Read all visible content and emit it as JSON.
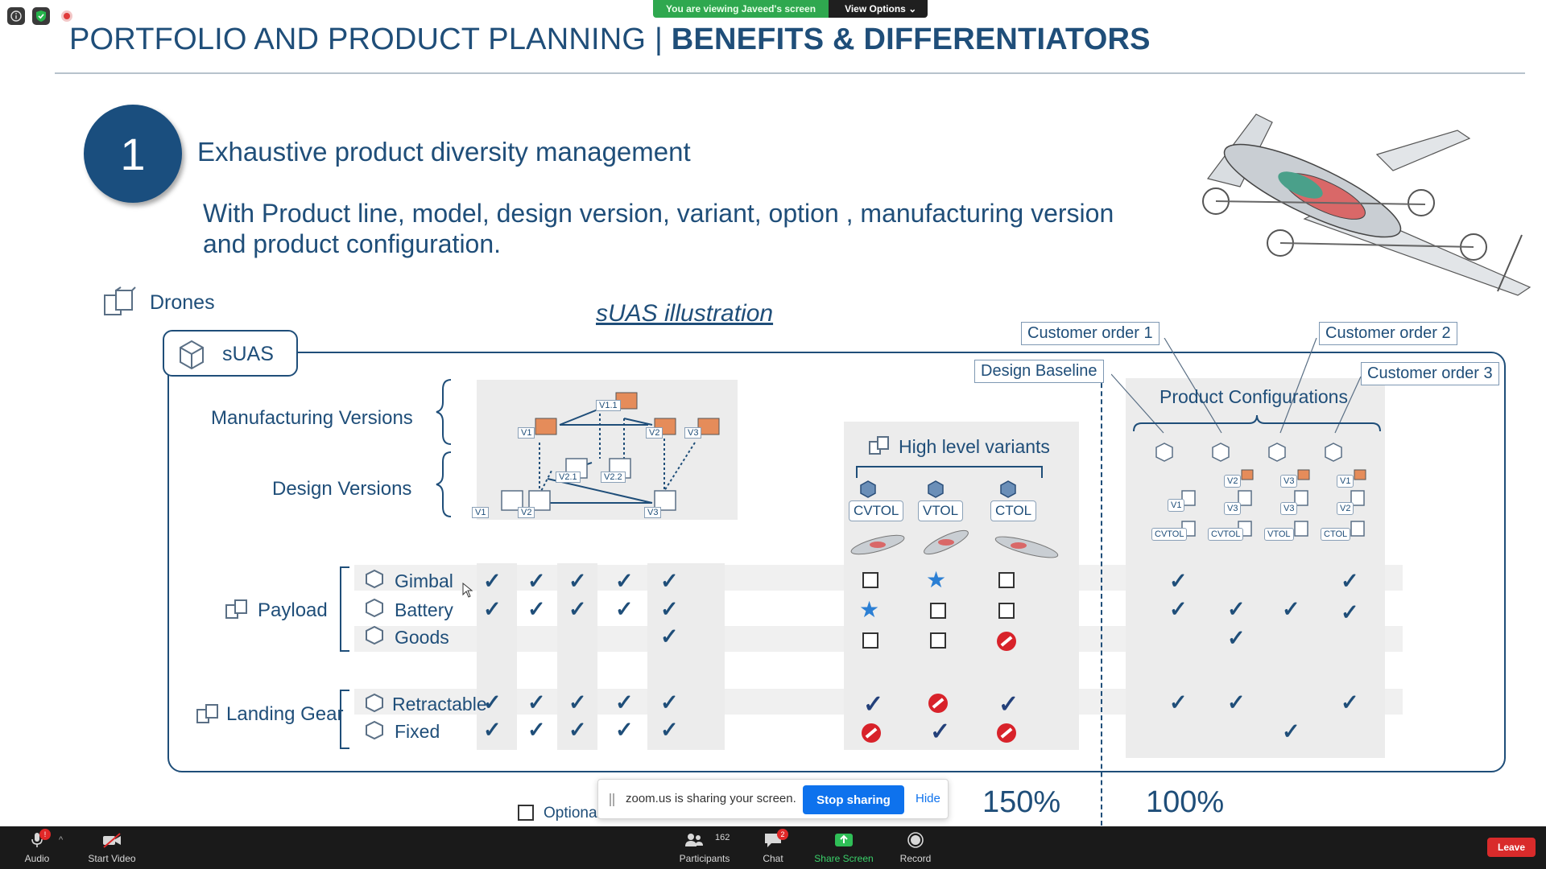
{
  "zoom_top": {
    "viewing_text": "You are viewing Javeed's screen",
    "view_options": "View Options",
    "icons": [
      "info-icon",
      "shield-icon",
      "record-indicator-icon"
    ]
  },
  "slide": {
    "title_part1": "PORTFOLIO AND PRODUCT PLANNING",
    "title_sep": "|",
    "title_part2": "BENEFITS & DIFFERENTIATORS",
    "number": "1",
    "heading": "Exhaustive product diversity management",
    "subheading": "With Product line, model, design version, variant, option , manufacturing version and product configuration.",
    "drones_label": "Drones",
    "illustration_title": "sUAS illustration",
    "suas_label": "sUAS",
    "rows": {
      "manufacturing_versions": "Manufacturing  Versions",
      "design_versions": "Design Versions",
      "payload": "Payload",
      "landing_gear": "Landing Gear"
    },
    "items": {
      "gimbal": "Gimbal",
      "battery": "Battery",
      "goods": "Goods",
      "retractable": "Retractable",
      "fixed": "Fixed"
    },
    "version_tags": {
      "v1": "V1",
      "v1_1": "V1.1",
      "v2": "V2",
      "v3": "V3",
      "v2_1": "V2.1",
      "v2_2": "V2.2"
    },
    "high_level_variants": "High level variants",
    "variants": [
      "CVTOL",
      "VTOL",
      "CTOL"
    ],
    "design_baseline": "Design Baseline",
    "product_configurations": "Product Configurations",
    "customer_orders": [
      "Customer order 1",
      "Customer order 2",
      "Customer order 3"
    ],
    "config_labels": [
      "CVTOL",
      "CVTOL",
      "VTOL",
      "CTOL"
    ],
    "config_tags": {
      "c1": [
        "V1"
      ],
      "c2": [
        "V2",
        "V3"
      ],
      "c3": [
        "V3",
        "V3"
      ],
      "c4": [
        "V1",
        "V2"
      ]
    },
    "optional_label": "Optional",
    "pct_left": "150%",
    "pct_right": "100%"
  },
  "share_bar": {
    "message": "zoom.us is sharing your screen.",
    "stop_label": "Stop sharing",
    "hide_label": "Hide"
  },
  "toolbar": {
    "audio": "Audio",
    "start_video": "Start Video",
    "participants": "Participants",
    "participants_count": "162",
    "chat": "Chat",
    "chat_badge": "2",
    "audio_badge": "!",
    "share_screen": "Share Screen",
    "record": "Record",
    "leave": "Leave"
  },
  "colors": {
    "slide_blue": "#1f4e79",
    "zoom_green": "#2fa84f",
    "zoom_blue": "#0e72ed",
    "leave_red": "#d92b2b",
    "star_blue": "#2b7fd4",
    "no_red": "#d8222a"
  }
}
